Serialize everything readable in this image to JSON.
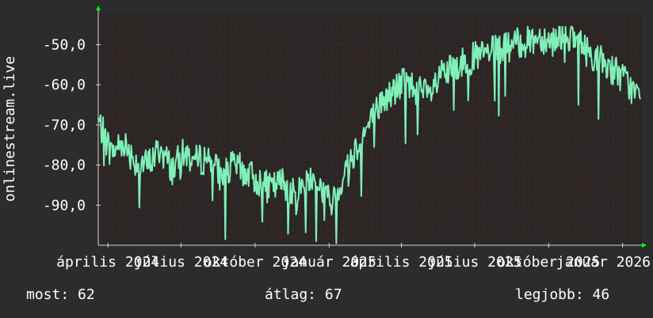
{
  "chart_data": {
    "type": "line",
    "title": "",
    "xlabel": "",
    "ylabel": "onlinestream.live",
    "ylim": [
      -100,
      -42
    ],
    "y_ticks": [
      -50,
      -60,
      -70,
      -80,
      -90
    ],
    "y_tick_labels": [
      "-50,0",
      "-60,0",
      "-70,0",
      "-80,0",
      "-90,0"
    ],
    "x_tick_labels": [
      "április 2024",
      "július 2024",
      "október 2024",
      "január 2025",
      "április 2025",
      "július 2025",
      "október 2025",
      "január 2026"
    ],
    "x_range": [
      "2024-03-20",
      "2026-01-23"
    ],
    "x_ticks": [
      "2024-04-01",
      "2024-07-01",
      "2024-10-01",
      "2025-01-01",
      "2025-04-01",
      "2025-07-01",
      "2025-10-01",
      "2026-01-01"
    ],
    "grid": true,
    "colors": {
      "line": "#7ff0b8",
      "grid": "#8b1a1a",
      "arrow": "#00ff00",
      "background": "#2c2c2c",
      "plot_background": "#272727"
    },
    "series": [
      {
        "name": "",
        "x": [
          "2024-03-20",
          "2024-04-05",
          "2024-04-20",
          "2024-05-05",
          "2024-05-20",
          "2024-06-05",
          "2024-06-20",
          "2024-07-05",
          "2024-07-20",
          "2024-08-05",
          "2024-08-20",
          "2024-09-05",
          "2024-09-20",
          "2024-10-05",
          "2024-10-20",
          "2024-11-05",
          "2024-11-20",
          "2024-12-05",
          "2024-12-20",
          "2025-01-05",
          "2025-01-20",
          "2025-02-05",
          "2025-02-20",
          "2025-03-05",
          "2025-03-20",
          "2025-04-05",
          "2025-04-20",
          "2025-05-05",
          "2025-05-20",
          "2025-06-05",
          "2025-06-20",
          "2025-07-05",
          "2025-07-20",
          "2025-08-05",
          "2025-08-20",
          "2025-09-05",
          "2025-09-20",
          "2025-10-05",
          "2025-10-20",
          "2025-11-05",
          "2025-11-20",
          "2025-12-05",
          "2025-12-20",
          "2026-01-05",
          "2026-01-20"
        ],
        "y": [
          -69,
          -77,
          -74,
          -79,
          -80,
          -76,
          -81,
          -77,
          -79,
          -78,
          -83,
          -80,
          -82,
          -84,
          -86,
          -84,
          -88,
          -83,
          -85,
          -90,
          -82,
          -75,
          -70,
          -65,
          -62,
          -59,
          -61,
          -63,
          -58,
          -56,
          -54,
          -53,
          -52,
          -51,
          -50,
          -49,
          -48,
          -49,
          -47,
          -49,
          -52,
          -54,
          -56,
          -59,
          -63
        ]
      }
    ],
    "stats": {
      "now_label": "most:",
      "now_value": "62",
      "avg_label": "átlag:",
      "avg_value": "67",
      "best_label": "legjobb:",
      "best_value": "46"
    }
  }
}
